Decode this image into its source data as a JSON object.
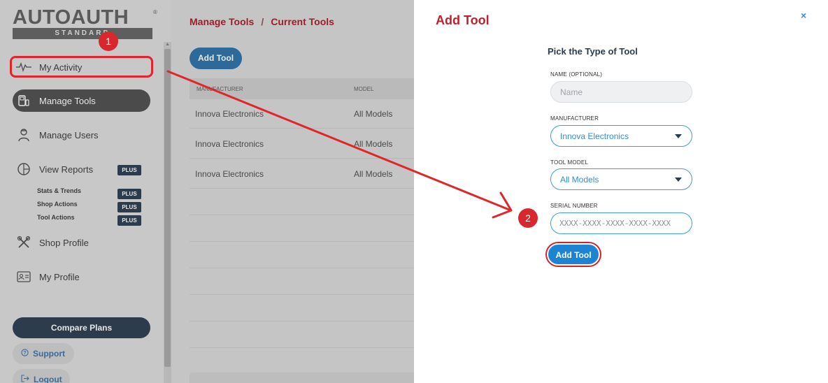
{
  "brand": {
    "name": "AUTOAUTH",
    "registered": "®",
    "tier": "STANDARD"
  },
  "sidebar": {
    "items": [
      {
        "label": "My Activity",
        "icon": "activity-icon"
      },
      {
        "label": "Manage Tools",
        "icon": "tools-icon"
      },
      {
        "label": "Manage Users",
        "icon": "users-icon"
      },
      {
        "label": "View Reports",
        "icon": "reports-icon",
        "badge": "PLUS"
      },
      {
        "label": "Shop Profile",
        "icon": "shop-icon"
      },
      {
        "label": "My Profile",
        "icon": "profile-icon"
      }
    ],
    "subitems": [
      {
        "label": "Stats & Trends",
        "badge": "PLUS"
      },
      {
        "label": "Shop Actions",
        "badge": "PLUS"
      },
      {
        "label": "Tool Actions",
        "badge": "PLUS"
      }
    ],
    "compare_label": "Compare Plans",
    "support_label": "Support",
    "logout_label": "Logout"
  },
  "content": {
    "breadcrumb": [
      "Manage Tools",
      "/",
      "Current Tools"
    ],
    "add_tool_label": "Add Tool",
    "table": {
      "columns": [
        "MANUFACTURER",
        "MODEL"
      ],
      "rows": [
        [
          "Innova Electronics",
          "All Models"
        ],
        [
          "Innova Electronics",
          "All Models"
        ],
        [
          "Innova Electronics",
          "All Models"
        ]
      ]
    }
  },
  "modal": {
    "title": "Add Tool",
    "close": "×",
    "heading": "Pick the Type of Tool",
    "fields": {
      "name": {
        "label": "NAME (OPTIONAL)",
        "placeholder": "Name"
      },
      "manufacturer": {
        "label": "MANUFACTURER",
        "value": "Innova Electronics"
      },
      "tool_model": {
        "label": "TOOL MODEL",
        "value": "All Models"
      },
      "serial": {
        "label": "SERIAL NUMBER",
        "placeholder": "XXXX-XXXX-XXXX-XXXX-XXXX"
      }
    },
    "submit_label": "Add Tool"
  },
  "annotations": {
    "step1": "1",
    "step2": "2",
    "color": "#e0262b"
  }
}
